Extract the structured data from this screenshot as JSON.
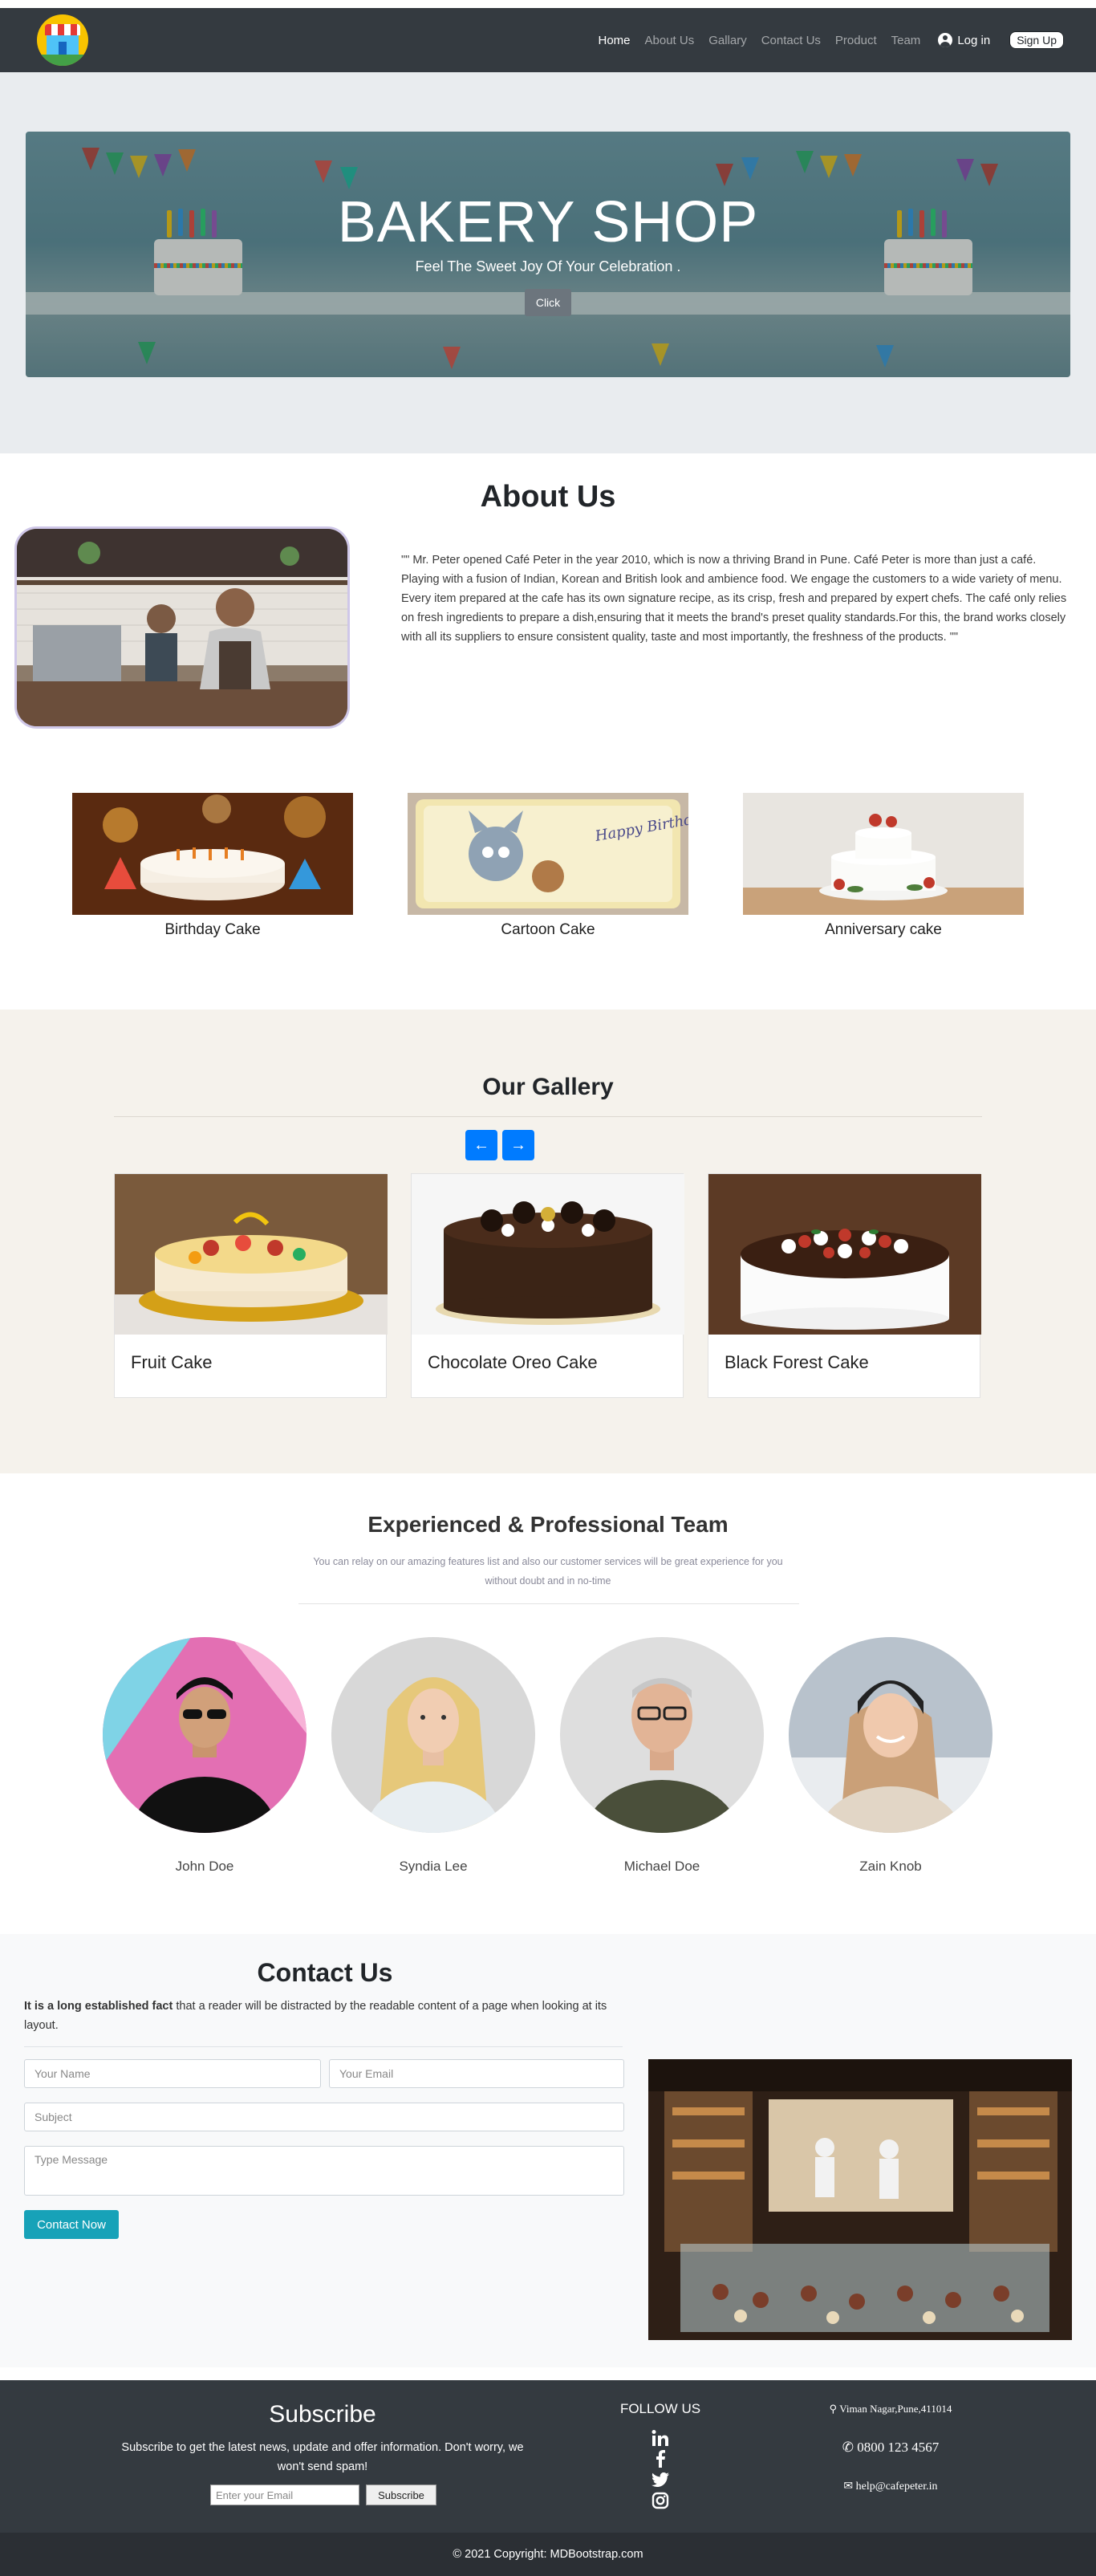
{
  "nav": {
    "links": [
      "Home",
      "About Us",
      "Gallary",
      "Contact Us",
      "Product",
      "Team"
    ],
    "login_label": "Log in",
    "signup_label": "Sign Up"
  },
  "hero": {
    "title": "BAKERY SHOP",
    "subtitle": "Feel The Sweet Joy Of Your Celebration .",
    "button_label": "Click"
  },
  "about": {
    "title": "About Us",
    "text": "\"\" Mr. Peter opened Café Peter in the year 2010, which is now a thriving Brand in Pune. Café Peter is more than just a café. Playing with a fusion of Indian, Korean and British look and ambience food. We engage the customers to a wide variety of menu. Every item prepared at the cafe has its own signature recipe, as its crisp, fresh and prepared by expert chefs. The café only relies on fresh ingredients to prepare a dish,ensuring that it meets the brand's preset quality standards.For this, the brand works closely with all its suppliers to ensure consistent quality, taste and most importantly, the freshness of the products. \"\"",
    "cakes": [
      "Birthday Cake",
      "Cartoon Cake",
      "Anniversary cake"
    ],
    "cartoon_cake_lettering": "Happy Birthday"
  },
  "gallery": {
    "title": "Our Gallery",
    "items": [
      "Fruit Cake",
      "Chocolate Oreo Cake",
      "Black Forest Cake"
    ]
  },
  "team": {
    "title": "Experienced & Professional Team",
    "subtitle": "You can relay on our amazing features list and also our customer services will be great experience for you without doubt and in no-time",
    "members": [
      "John Doe",
      "Syndia Lee",
      "Michael Doe",
      "Zain Knob"
    ]
  },
  "contact": {
    "title": "Contact Us",
    "intro_bold": "It is a long established fact",
    "intro_rest": " that a reader will be distracted by the readable content of a page when looking at its layout.",
    "placeholders": {
      "name": "Your Name",
      "email": "Your Email",
      "subject": "Subject",
      "message": "Type Message"
    },
    "button_label": "Contact Now"
  },
  "footer": {
    "subscribe_title": "Subscribe",
    "subscribe_text": "Subscribe to get the latest news, update and offer information. Don't worry, we won't send spam!",
    "email_placeholder": "Enter your Email",
    "subscribe_button": "Subscribe",
    "follow_title": "FOLLOW US",
    "social": [
      "linkedin-icon",
      "facebook-icon",
      "twitter-icon",
      "instagram-icon"
    ],
    "address": "Viman Nagar,Pune,411014",
    "phone": "0800 123 4567",
    "email": "help@cafepeter.in",
    "copyright": "© 2021 Copyright: MDBootstrap.com"
  },
  "colors": {
    "navbar": "#343a40",
    "primary": "#007bff",
    "info": "#17a2b8",
    "secondary": "#6c757d"
  }
}
